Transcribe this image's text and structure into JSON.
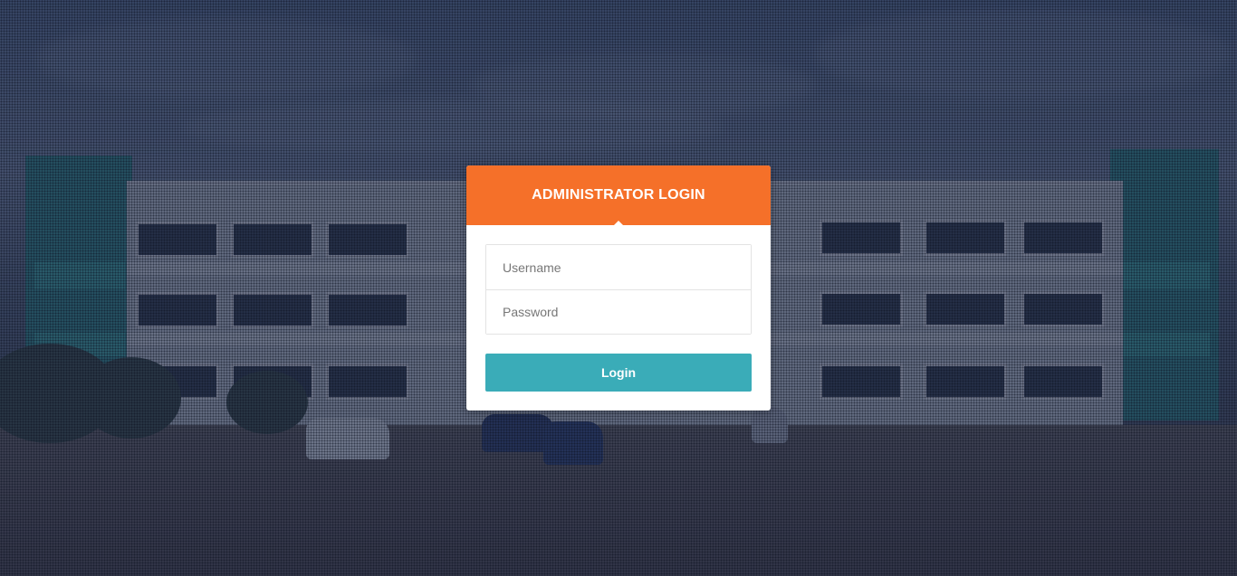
{
  "login": {
    "title": "ADMINISTRATOR LOGIN",
    "username_placeholder": "Username",
    "password_placeholder": "Password",
    "username_value": "",
    "password_value": "",
    "submit_label": "Login"
  },
  "colors": {
    "header": "#f57029",
    "button": "#3aacb8",
    "overlay": "#1e2a48"
  }
}
